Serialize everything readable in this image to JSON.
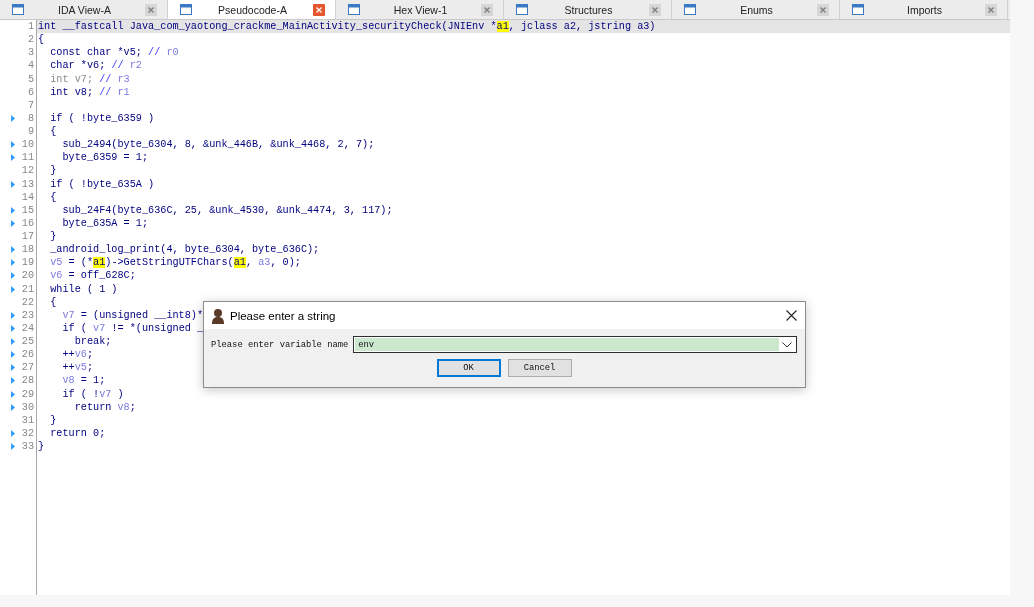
{
  "tabs": [
    {
      "label": "IDA View-A",
      "selected": false
    },
    {
      "label": "Pseudocode-A",
      "selected": true
    },
    {
      "label": "Hex View-1",
      "selected": false
    },
    {
      "label": "Structures",
      "selected": false
    },
    {
      "label": "Enums",
      "selected": false
    },
    {
      "label": "Imports",
      "selected": false
    }
  ],
  "code": {
    "lines": [
      {
        "number": "1",
        "marker": false,
        "current": true,
        "tokens": [
          {
            "kind": "plain",
            "text": "int __fastcall Java_com_yaotong_crackme_MainActivity_securityCheck(JNIEnv *"
          },
          {
            "kind": "match",
            "text": "a1"
          },
          {
            "kind": "plain",
            "text": ", jclass a2, jstring a3)"
          }
        ]
      },
      {
        "number": "2",
        "marker": false,
        "current": false,
        "tokens": [
          {
            "kind": "plain",
            "text": "{"
          }
        ]
      },
      {
        "number": "3",
        "marker": false,
        "current": false,
        "tokens": [
          {
            "kind": "plain",
            "text": "  const char *v5; "
          },
          {
            "kind": "comment",
            "text": "//"
          },
          {
            "kind": "var",
            "text": " r0"
          }
        ]
      },
      {
        "number": "4",
        "marker": false,
        "current": false,
        "tokens": [
          {
            "kind": "plain",
            "text": "  char *v6; "
          },
          {
            "kind": "comment",
            "text": "//"
          },
          {
            "kind": "var",
            "text": " r2"
          }
        ]
      },
      {
        "number": "5",
        "marker": false,
        "current": false,
        "tokens": [
          {
            "kind": "dim",
            "text": "  int v7; "
          },
          {
            "kind": "comment",
            "text": "//"
          },
          {
            "kind": "var",
            "text": " r3"
          }
        ]
      },
      {
        "number": "6",
        "marker": false,
        "current": false,
        "tokens": [
          {
            "kind": "plain",
            "text": "  int v8; "
          },
          {
            "kind": "comment",
            "text": "//"
          },
          {
            "kind": "var",
            "text": " r1"
          }
        ]
      },
      {
        "number": "7",
        "marker": false,
        "current": false
      },
      {
        "number": "8",
        "marker": true,
        "current": false,
        "tokens": [
          {
            "kind": "plain",
            "text": "  if ( !byte_6359 )"
          }
        ]
      },
      {
        "number": "9",
        "marker": false,
        "current": false,
        "tokens": [
          {
            "kind": "plain",
            "text": "  {"
          }
        ]
      },
      {
        "number": "10",
        "marker": true,
        "current": false,
        "tokens": [
          {
            "kind": "plain",
            "text": "    sub_2494(byte_6304, 8, &unk_446B, &unk_4468, 2, 7);"
          }
        ]
      },
      {
        "number": "11",
        "marker": true,
        "current": false,
        "tokens": [
          {
            "kind": "plain",
            "text": "    byte_6359 = 1;"
          }
        ]
      },
      {
        "number": "12",
        "marker": false,
        "current": false,
        "tokens": [
          {
            "kind": "plain",
            "text": "  }"
          }
        ]
      },
      {
        "number": "13",
        "marker": true,
        "current": false,
        "tokens": [
          {
            "kind": "plain",
            "text": "  if ( !byte_635A )"
          }
        ]
      },
      {
        "number": "14",
        "marker": false,
        "current": false,
        "tokens": [
          {
            "kind": "plain",
            "text": "  {"
          }
        ]
      },
      {
        "number": "15",
        "marker": true,
        "current": false,
        "tokens": [
          {
            "kind": "plain",
            "text": "    sub_24F4(byte_636C, 25, &unk_4530, &unk_4474, 3, 117);"
          }
        ]
      },
      {
        "number": "16",
        "marker": true,
        "current": false,
        "tokens": [
          {
            "kind": "plain",
            "text": "    byte_635A = 1;"
          }
        ]
      },
      {
        "number": "17",
        "marker": false,
        "current": false,
        "tokens": [
          {
            "kind": "plain",
            "text": "  }"
          }
        ]
      },
      {
        "number": "18",
        "marker": true,
        "current": false,
        "tokens": [
          {
            "kind": "plain",
            "text": "  _android_log_print(4, byte_6304, byte_636C);"
          }
        ]
      },
      {
        "number": "19",
        "marker": true,
        "current": false,
        "tokens": [
          {
            "kind": "var",
            "text": "  v5"
          },
          {
            "kind": "plain",
            "text": " = (*"
          },
          {
            "kind": "match",
            "text": "a1"
          },
          {
            "kind": "plain",
            "text": ")->GetStringUTFChars("
          },
          {
            "kind": "match",
            "text": "a1"
          },
          {
            "kind": "plain",
            "text": ", "
          },
          {
            "kind": "var",
            "text": "a3"
          },
          {
            "kind": "plain",
            "text": ", 0);"
          }
        ]
      },
      {
        "number": "20",
        "marker": true,
        "current": false,
        "tokens": [
          {
            "kind": "var",
            "text": "  v6"
          },
          {
            "kind": "plain",
            "text": " = off_628C;"
          }
        ]
      },
      {
        "number": "21",
        "marker": true,
        "current": false,
        "tokens": [
          {
            "kind": "plain",
            "text": "  while ( 1 )"
          }
        ]
      },
      {
        "number": "22",
        "marker": false,
        "current": false,
        "tokens": [
          {
            "kind": "plain",
            "text": "  {"
          }
        ]
      },
      {
        "number": "23",
        "marker": true,
        "current": false,
        "tokens": [
          {
            "kind": "var",
            "text": "    v7"
          },
          {
            "kind": "plain",
            "text": " = (unsigned __int8)*"
          }
        ]
      },
      {
        "number": "24",
        "marker": true,
        "current": false,
        "tokens": [
          {
            "kind": "plain",
            "text": "    if ( "
          },
          {
            "kind": "var",
            "text": "v7"
          },
          {
            "kind": "plain",
            "text": " != *(unsigned _"
          }
        ]
      },
      {
        "number": "25",
        "marker": true,
        "current": false,
        "tokens": [
          {
            "kind": "plain",
            "text": "      break;"
          }
        ]
      },
      {
        "number": "26",
        "marker": true,
        "current": false,
        "tokens": [
          {
            "kind": "plain",
            "text": "    ++"
          },
          {
            "kind": "var",
            "text": "v6"
          },
          {
            "kind": "plain",
            "text": ";"
          }
        ]
      },
      {
        "number": "27",
        "marker": true,
        "current": false,
        "tokens": [
          {
            "kind": "plain",
            "text": "    ++"
          },
          {
            "kind": "var",
            "text": "v5"
          },
          {
            "kind": "plain",
            "text": ";"
          }
        ]
      },
      {
        "number": "28",
        "marker": true,
        "current": false,
        "tokens": [
          {
            "kind": "var",
            "text": "    v8"
          },
          {
            "kind": "plain",
            "text": " = 1;"
          }
        ]
      },
      {
        "number": "29",
        "marker": true,
        "current": false,
        "tokens": [
          {
            "kind": "plain",
            "text": "    if ( !"
          },
          {
            "kind": "var",
            "text": "v7"
          },
          {
            "kind": "plain",
            "text": " )"
          }
        ]
      },
      {
        "number": "30",
        "marker": true,
        "current": false,
        "tokens": [
          {
            "kind": "plain",
            "text": "      return "
          },
          {
            "kind": "var",
            "text": "v8"
          },
          {
            "kind": "plain",
            "text": ";"
          }
        ]
      },
      {
        "number": "31",
        "marker": false,
        "current": false,
        "tokens": [
          {
            "kind": "plain",
            "text": "  }"
          }
        ]
      },
      {
        "number": "32",
        "marker": true,
        "current": false,
        "tokens": [
          {
            "kind": "plain",
            "text": "  return 0;"
          }
        ]
      },
      {
        "number": "33",
        "marker": true,
        "current": false,
        "tokens": [
          {
            "kind": "plain",
            "text": "}"
          }
        ]
      }
    ]
  },
  "dialog": {
    "title": "Please enter a string",
    "field": {
      "label": "Please enter variable name",
      "value": "env"
    },
    "buttons": [
      {
        "label": "OK",
        "default": true
      },
      {
        "label": "Cancel",
        "default": false
      }
    ]
  }
}
